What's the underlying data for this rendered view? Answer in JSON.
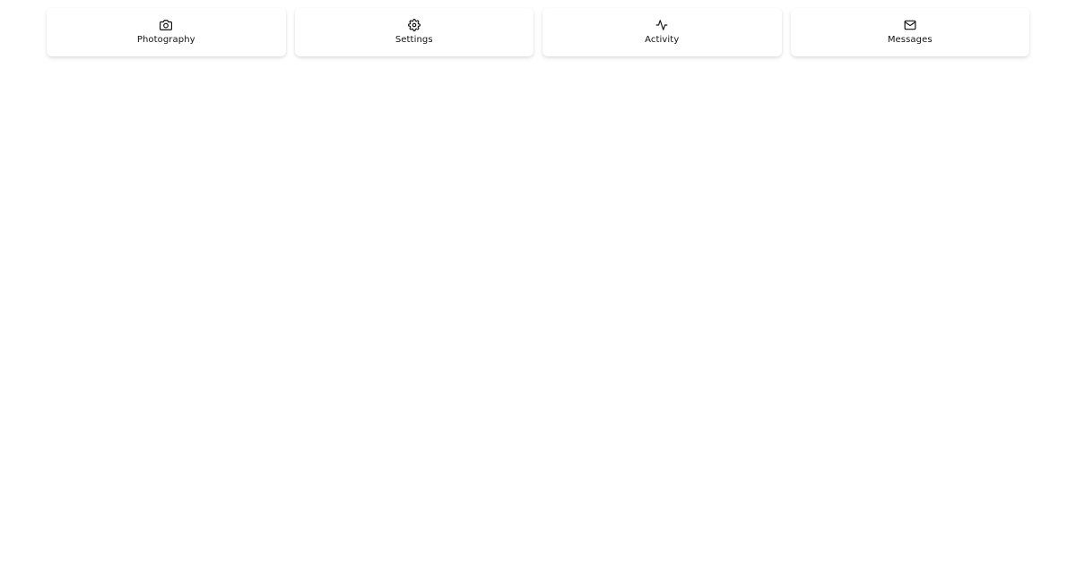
{
  "cards": [
    {
      "label": "Photography",
      "icon": "camera-icon"
    },
    {
      "label": "Settings",
      "icon": "gear-icon"
    },
    {
      "label": "Activity",
      "icon": "activity-icon"
    },
    {
      "label": "Messages",
      "icon": "mail-icon"
    }
  ],
  "colors": {
    "background": "#ffffff",
    "text": "#111111"
  }
}
